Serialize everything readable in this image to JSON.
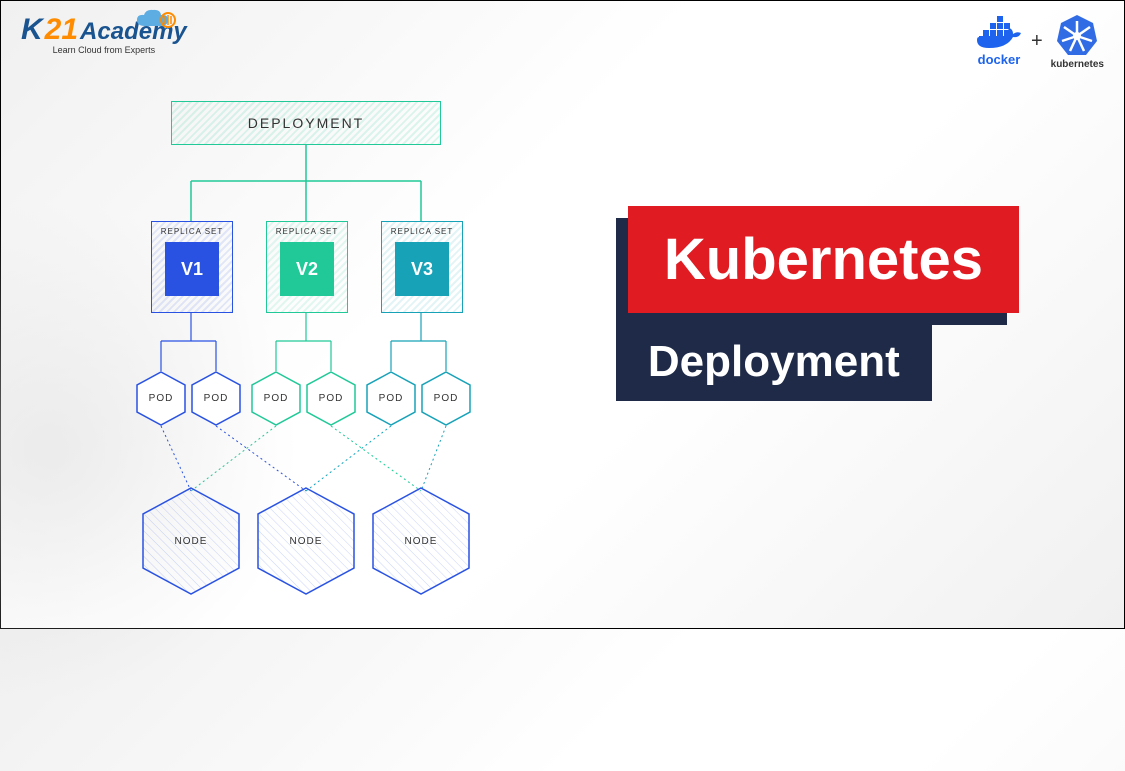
{
  "logo": {
    "brand_k": "K",
    "brand_21": "21",
    "brand_academy": "Academy",
    "tagline": "Learn Cloud from Experts"
  },
  "top_right": {
    "docker_label": "docker",
    "plus": "+",
    "kubernetes_label": "kubernetes"
  },
  "title": {
    "line1": "Kubernetes",
    "line2": "Deployment"
  },
  "diagram": {
    "deployment_label": "DEPLOYMENT",
    "replica_set_label": "REPLICA SET",
    "replica_versions": [
      "V1",
      "V2",
      "V3"
    ],
    "pod_label": "POD",
    "node_label": "NODE",
    "colors": {
      "v1": "#2952e3",
      "v2": "#20c997",
      "v3": "#17a2b8",
      "deployment_border": "#20c997",
      "node_border": "#2952e3"
    },
    "structure": {
      "deployment_children": [
        "ReplicaSet V1",
        "ReplicaSet V2",
        "ReplicaSet V3"
      ],
      "pods_per_replica": 2,
      "nodes": 3
    }
  }
}
